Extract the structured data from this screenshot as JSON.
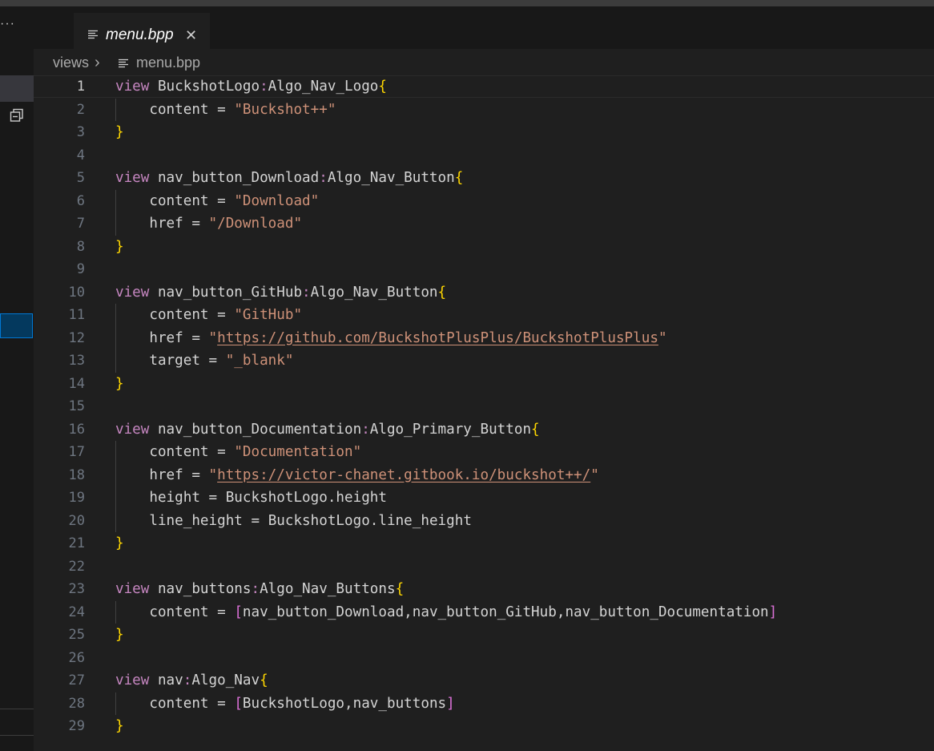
{
  "sidebar": {
    "more_label": "···"
  },
  "tab": {
    "label": "menu.bpp",
    "close_label": "✕"
  },
  "breadcrumb": {
    "folder": "views",
    "separator": "›",
    "file": "menu.bpp"
  },
  "editor": {
    "active_line": 1,
    "line_numbers": [
      "1",
      "2",
      "3",
      "4",
      "5",
      "6",
      "7",
      "8",
      "9",
      "10",
      "11",
      "12",
      "13",
      "14",
      "15",
      "16",
      "17",
      "18",
      "19",
      "20",
      "21",
      "22",
      "23",
      "24",
      "25",
      "26",
      "27",
      "28",
      "29"
    ],
    "lines": [
      "view BuckshotLogo:Algo_Nav_Logo{",
      "    content = \"Buckshot++\"",
      "}",
      "",
      "view nav_button_Download:Algo_Nav_Button{",
      "    content = \"Download\"",
      "    href = \"/Download\"",
      "}",
      "",
      "view nav_button_GitHub:Algo_Nav_Button{",
      "    content = \"GitHub\"",
      "    href = \"https://github.com/BuckshotPlusPlus/BuckshotPlusPlus\"",
      "    target = \"_blank\"",
      "}",
      "",
      "view nav_button_Documentation:Algo_Primary_Button{",
      "    content = \"Documentation\"",
      "    href = \"https://victor-chanet.gitbook.io/buckshot++/\"",
      "    height = BuckshotLogo.height",
      "    line_height = BuckshotLogo.line_height",
      "}",
      "",
      "view nav_buttons:Algo_Nav_Buttons{",
      "    content = [nav_button_Download,nav_button_GitHub,nav_button_Documentation]",
      "}",
      "",
      "view nav:Algo_Nav{",
      "    content = [BuckshotLogo,nav_buttons]",
      "}"
    ]
  },
  "colors": {
    "keyword": "#c586c0",
    "identifier": "#d4d4d4",
    "brace": "#ffd700",
    "square_bracket": "#da70d6",
    "string": "#ce9178",
    "line_number": "#6e7681",
    "background": "#1f1f1f"
  }
}
